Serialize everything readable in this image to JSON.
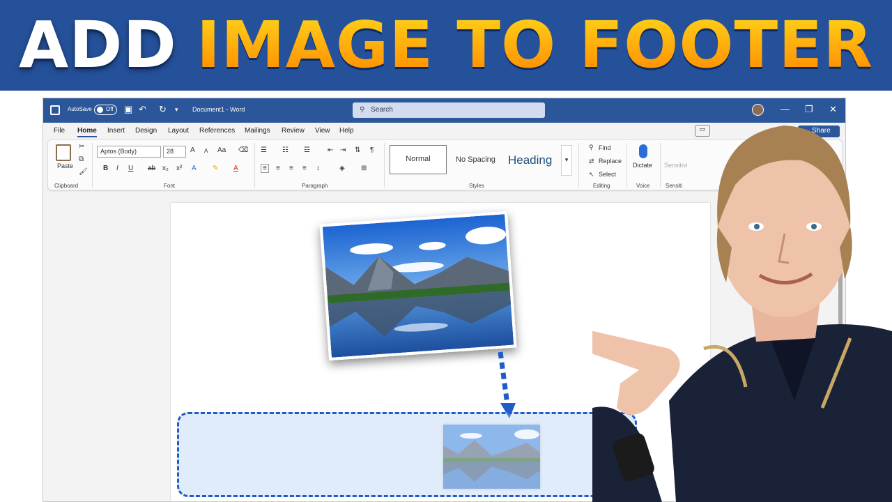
{
  "banner": {
    "word1": "ADD",
    "word2": "IMAGE TO FOOTER"
  },
  "titlebar": {
    "autosave_label": "AutoSave",
    "autosave_state": "Off",
    "document_title": "Document1 - Word",
    "search_placeholder": "Search",
    "minimize_glyph": "—",
    "restore_glyph": "❐",
    "close_glyph": "✕"
  },
  "menu": {
    "tabs": [
      "File",
      "Home",
      "Insert",
      "Design",
      "Layout",
      "References",
      "Mailings",
      "Review",
      "View",
      "Help"
    ],
    "share_label": "Share"
  },
  "ribbon": {
    "clipboard": {
      "paste_label": "Paste",
      "group_label": "Clipboard"
    },
    "font": {
      "font_name": "Aptos (Body)",
      "font_size": "28",
      "bold": "B",
      "italic": "I",
      "underline": "U",
      "strikethrough": "ab",
      "subscript": "x₂",
      "superscript": "x²",
      "grow": "A",
      "shrink": "A",
      "case": "Aa",
      "group_label": "Font"
    },
    "paragraph": {
      "group_label": "Paragraph"
    },
    "styles": {
      "normal": "Normal",
      "no_spacing": "No Spacing",
      "heading": "Heading",
      "group_label": "Styles"
    },
    "editing": {
      "find": "Find",
      "replace": "Replace",
      "select": "Select",
      "group_label": "Editing"
    },
    "voice": {
      "dictate": "Dictate",
      "group_label": "Voice"
    },
    "sensitivity": {
      "label": "Sensitivi",
      "group_label": "Sensiti"
    }
  },
  "colors": {
    "banner_bg": "#25519b",
    "word_blue": "#2b579a",
    "footer_dash": "#1f5cc7",
    "title_orange": "#ff9a00"
  },
  "icons": [
    "word-app-icon",
    "save-icon",
    "undo-icon",
    "redo-icon",
    "search-icon",
    "paste-icon",
    "cut-icon",
    "copy-icon",
    "format-painter-icon",
    "microphone-icon",
    "find-icon",
    "replace-icon",
    "select-icon"
  ]
}
